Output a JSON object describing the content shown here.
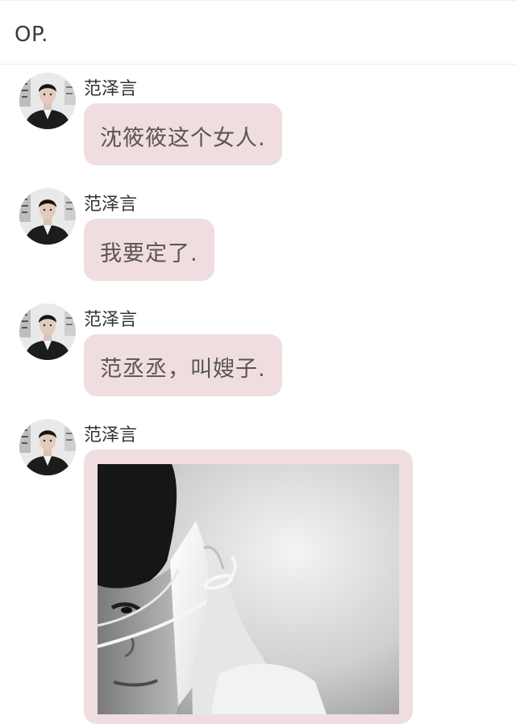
{
  "header": {
    "title": "OP."
  },
  "messages": [
    {
      "sender": "范泽言",
      "text": "沈筱筱这个女人."
    },
    {
      "sender": "范泽言",
      "text": "我要定了."
    },
    {
      "sender": "范泽言",
      "text": "范丞丞，叫嫂子."
    },
    {
      "sender": "范泽言",
      "image": "black-and-white-portrait-photo"
    }
  ],
  "colors": {
    "bubble": "#efdde0",
    "text": "#595555",
    "sender": "#333333"
  }
}
